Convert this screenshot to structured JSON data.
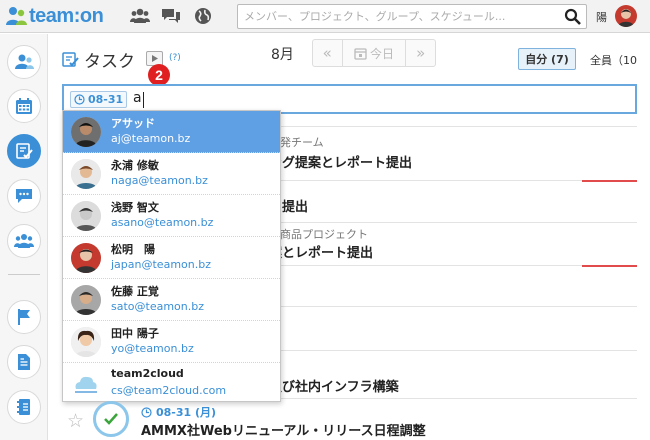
{
  "app": {
    "logo_text": "team:on",
    "search_placeholder": "メンバー、プロジェクト、グループ、スケジュール...",
    "user_label": "陽"
  },
  "header": {
    "title": "タスク",
    "help": "(?)",
    "badge": "2",
    "month": "8月",
    "nav_prev": "«",
    "nav_today": "今日",
    "nav_next": "»",
    "own_filter": "自分 (7)",
    "all_filter": "全員（10"
  },
  "task_input": {
    "date": "08-31",
    "typed_value": "a"
  },
  "suggestions": [
    {
      "name": "アサッド",
      "email": "aj@teamon.bz",
      "selected": true
    },
    {
      "name": "永浦 修敏",
      "email": "naga@teamon.bz"
    },
    {
      "name": "浅野 智文",
      "email": "asano@teamon.bz"
    },
    {
      "name": "松明　陽",
      "email": "japan@teamon.bz"
    },
    {
      "name": "佐藤 正覚",
      "email": "sato@teamon.bz"
    },
    {
      "name": "田中 陽子",
      "email": "yo@teamon.bz"
    },
    {
      "name": "team2cloud",
      "email": "cs@team2cloud.com"
    }
  ],
  "background_tasks": [
    {
      "sub": "開発チーム",
      "title": "ング提案とレポート提出"
    },
    {
      "title": "を提出"
    },
    {
      "sub": "新商品プロジェクト",
      "title": "案とレポート提出"
    },
    {
      "title": "及び社内インフラ構築"
    }
  ],
  "bottom_task": {
    "date": "08-31 (月)",
    "title": "AMMX社Webリニューアル・リリース日程調整"
  },
  "colors": {
    "brand": "#3a8fd6",
    "selection": "#5f9fe4",
    "badge": "#e02020"
  }
}
